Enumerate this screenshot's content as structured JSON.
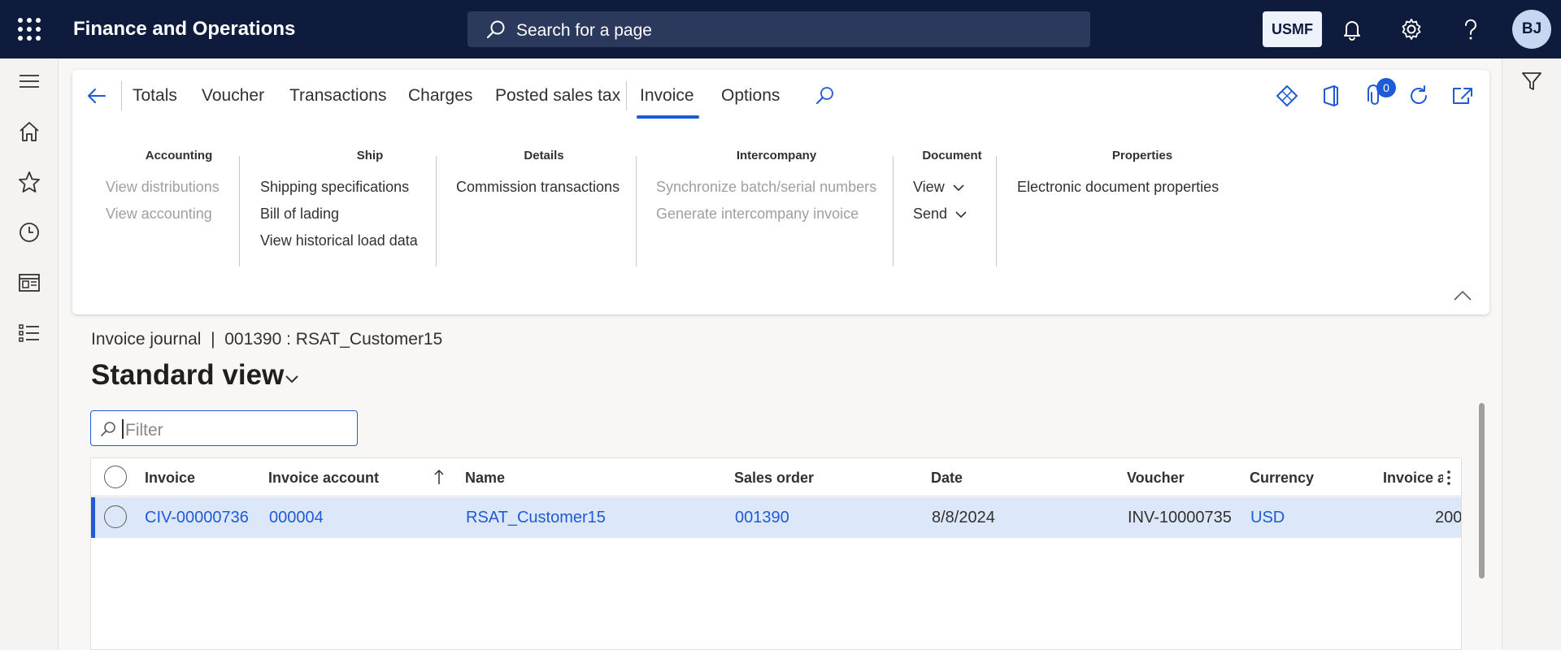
{
  "app": {
    "title": "Finance and Operations"
  },
  "search": {
    "placeholder": "Search for a page"
  },
  "header": {
    "company": "USMF",
    "avatar_initials": "BJ"
  },
  "icons": {
    "waffle": "waffle-icon",
    "search": "search-icon",
    "bell": "bell-icon",
    "gear": "gear-icon",
    "help": "help-icon",
    "hamburger": "hamburger-icon",
    "home": "home-icon",
    "star": "star-icon",
    "clock": "clock-icon",
    "workspace": "workspace-icon",
    "list": "list-icon",
    "filter_funnel": "filter-icon"
  },
  "action_pane": {
    "tabs": [
      "Totals",
      "Voucher",
      "Transactions",
      "Charges",
      "Posted sales tax",
      "Invoice",
      "Options"
    ],
    "active_tab": "Invoice",
    "attachments_count": "0",
    "groups": {
      "accounting": {
        "title": "Accounting",
        "items": [
          "View distributions",
          "View accounting"
        ]
      },
      "ship": {
        "title": "Ship",
        "items": [
          "Shipping specifications",
          "Bill of lading",
          "View historical load data"
        ]
      },
      "details": {
        "title": "Details",
        "items": [
          "Commission transactions"
        ]
      },
      "intercompany": {
        "title": "Intercompany",
        "items": [
          "Synchronize batch/serial numbers",
          "Generate intercompany invoice"
        ]
      },
      "document": {
        "title": "Document",
        "items": [
          "View",
          "Send"
        ]
      },
      "properties": {
        "title": "Properties",
        "items": [
          "Electronic document properties"
        ]
      }
    }
  },
  "page": {
    "breadcrumb": "Invoice journal  |  001390 : RSAT_Customer15",
    "view_title": "Standard view",
    "filter_placeholder": "Filter"
  },
  "grid": {
    "columns": [
      "Invoice",
      "Invoice account",
      "Name",
      "Sales order",
      "Date",
      "Voucher",
      "Currency",
      "Invoice a"
    ],
    "rows": [
      {
        "invoice": "CIV-00000736",
        "invoice_account": "000004",
        "name": "RSAT_Customer15",
        "sales_order": "001390",
        "date": "8/8/2024",
        "voucher": "INV-10000735",
        "currency": "USD",
        "invoice_amount": "200"
      }
    ]
  },
  "colors": {
    "topbar": "#0e1b3c",
    "accent": "#1f5bd6",
    "selected_row": "#dce7f9"
  }
}
